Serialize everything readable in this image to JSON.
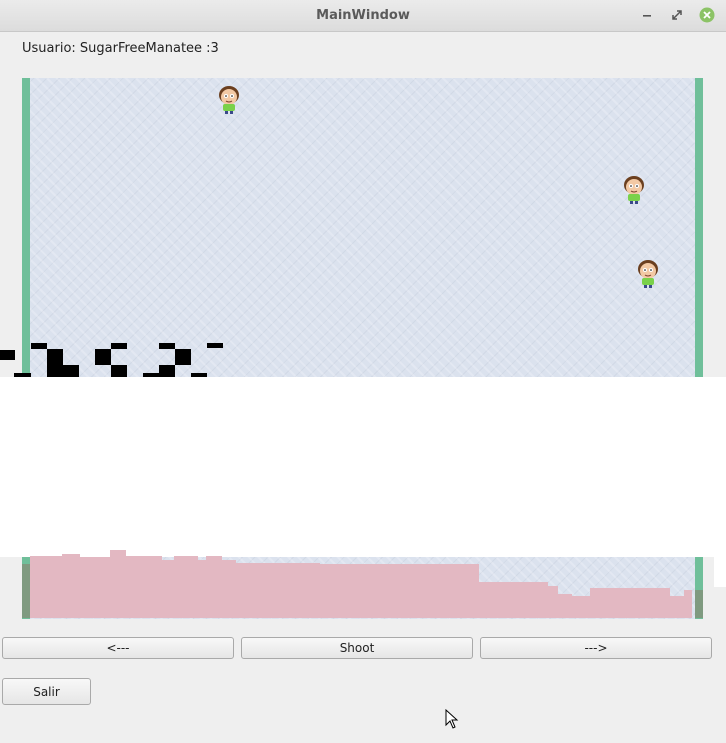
{
  "window": {
    "title": "MainWindow",
    "controls": [
      "minimize-icon",
      "maximize-icon",
      "close-icon"
    ]
  },
  "user_label": "Usuario: SugarFreeManatee :3",
  "game": {
    "enemies": [
      {
        "sprite": "morty-enemy"
      },
      {
        "sprite": "morty-enemy"
      },
      {
        "sprite": "morty-enemy"
      }
    ],
    "colors": {
      "background": "#dbe2ee",
      "walls": "#6fbf9a",
      "ground": "#e3b8c2",
      "barriers": "#000000"
    }
  },
  "controls": {
    "left_label": "<---",
    "shoot_label": "Shoot",
    "right_label": "--->",
    "exit_label": "Salir"
  }
}
